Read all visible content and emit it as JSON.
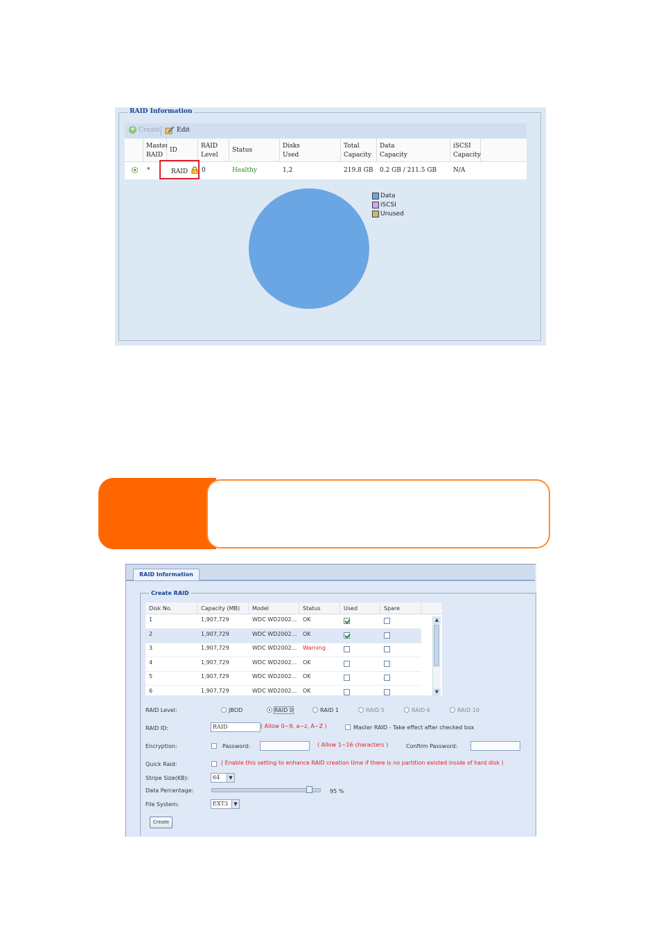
{
  "raid_info_panel": {
    "legend_title": "RAID Information",
    "toolbar": {
      "create_label": "Create",
      "edit_label": "Edit"
    },
    "columns": [
      "Master RAID",
      "ID",
      "RAID Level",
      "Status",
      "Disks Used",
      "Total Capacity",
      "Data Capacity",
      "iSCSI Capacity"
    ],
    "column_lines": [
      [
        "Master",
        "RAID"
      ],
      [
        "ID"
      ],
      [
        "RAID",
        "Level"
      ],
      [
        "Status"
      ],
      [
        "Disks",
        "Used"
      ],
      [
        "Total",
        "Capacity"
      ],
      [
        "Data",
        "Capacity"
      ],
      [
        "iSCSI",
        "Capacity"
      ]
    ],
    "row": {
      "master": "*",
      "id": "RAID",
      "level": "0",
      "status": "Healthy",
      "disks": "1,2",
      "total": "219.8 GB",
      "data": "0.2 GB / 211.5 GB",
      "iscsi": "N/A"
    },
    "status_color": "#2a8a2a"
  },
  "chart_data": {
    "type": "pie",
    "categories": [
      "Data",
      "iSCSI",
      "Unused"
    ],
    "values": [
      100,
      0,
      0
    ],
    "colors": [
      "#6aa6e3",
      "#c9a6e8",
      "#c8b87a"
    ],
    "legend_position": "right"
  },
  "create_raid_panel": {
    "tab_label": "RAID Information",
    "legend_title": "Create RAID",
    "columns": [
      "Disk No.",
      "Capacity (MB)",
      "Model",
      "Status",
      "Used",
      "Spare"
    ],
    "disks": [
      {
        "no": "1",
        "capacity": "1,907,729",
        "model": "WDC WD2002...",
        "status": "OK",
        "used": true,
        "spare": false,
        "selected": false
      },
      {
        "no": "2",
        "capacity": "1,907,729",
        "model": "WDC WD2002...",
        "status": "OK",
        "used": true,
        "spare": false,
        "selected": true
      },
      {
        "no": "3",
        "capacity": "1,907,729",
        "model": "WDC WD2002...",
        "status": "Warning",
        "used": false,
        "spare": false,
        "selected": false
      },
      {
        "no": "4",
        "capacity": "1,907,729",
        "model": "WDC WD2002...",
        "status": "OK",
        "used": false,
        "spare": false,
        "selected": false
      },
      {
        "no": "5",
        "capacity": "1,907,729",
        "model": "WDC WD2002...",
        "status": "OK",
        "used": false,
        "spare": false,
        "selected": false
      },
      {
        "no": "6",
        "capacity": "1,907,729",
        "model": "WDC WD2002...",
        "status": "OK",
        "used": false,
        "spare": false,
        "selected": false
      }
    ],
    "raid_level_label": "RAID Level:",
    "raid_levels": [
      "JBOD",
      "RAID 0",
      "RAID 1",
      "RAID 5",
      "RAID 6",
      "RAID 10"
    ],
    "raid_level_selected": "RAID 0",
    "raid_id_label": "RAID ID:",
    "raid_id_value": "RAID",
    "raid_id_hint": "( Allow 0~9, a~z, A~Z )",
    "master_raid_label": "Master RAID - Take effect after checked box",
    "encryption_label": "Encryption:",
    "password_label": "Password:",
    "password_hint": "( Allow 1~16 characters )",
    "confirm_label": "Confirm Password:",
    "quick_raid_label": "Quick Raid:",
    "quick_raid_hint": "( Enable this setting to enhance RAID creation time if there is no partition existed inside of hard disk )",
    "stripe_label": "Stripe Size(KB):",
    "stripe_value": "64",
    "data_pct_label": "Data Percentage:",
    "data_pct_value": "95 %",
    "data_pct": 95,
    "fs_label": "File System:",
    "fs_value": "EXT3",
    "create_button": "Create"
  },
  "colors": {
    "accent_orange": "#ff6600",
    "panel_bg": "#dde8f5",
    "header_blue": "#15428b"
  }
}
